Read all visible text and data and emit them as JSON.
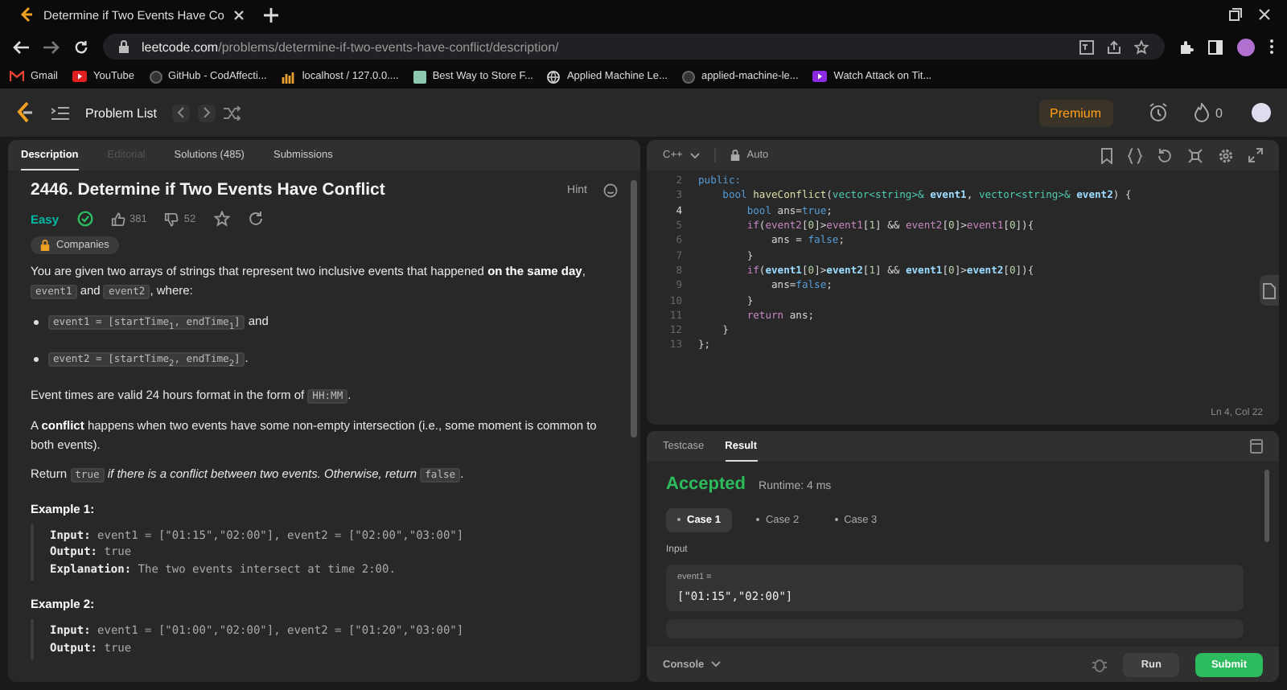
{
  "browser": {
    "tab_title": "Determine if Two Events Have Co",
    "url_host": "leetcode.com",
    "url_path": "/problems/determine-if-two-events-have-conflict/description/",
    "bookmarks": [
      "Gmail",
      "YouTube",
      "GitHub - CodAffecti...",
      "localhost / 127.0.0....",
      "Best Way to Store F...",
      "Applied Machine Le...",
      "applied-machine-le...",
      "Watch Attack on Tit..."
    ]
  },
  "navbar": {
    "title": "Problem List",
    "premium": "Premium",
    "streak": "0"
  },
  "description_panel": {
    "tabs": [
      {
        "label": "Description",
        "selected": true,
        "disabled": false
      },
      {
        "label": "Editorial",
        "selected": false,
        "disabled": true
      },
      {
        "label": "Solutions (485)",
        "selected": false,
        "disabled": false
      },
      {
        "label": "Submissions",
        "selected": false,
        "disabled": false
      }
    ],
    "title": "2446. Determine if Two Events Have Conflict",
    "hint": "Hint",
    "difficulty": "Easy",
    "solved": true,
    "likes": "381",
    "dislikes": "52",
    "companies": "Companies",
    "paragraphs": [
      {
        "kind": "text",
        "segments": [
          {
            "kind": "text",
            "text": "You are given two arrays of strings that represent two inclusive events that happened "
          },
          {
            "kind": "bold",
            "text": "on the same day"
          },
          {
            "kind": "text",
            "text": ", "
          },
          {
            "kind": "code",
            "text": "event1"
          },
          {
            "kind": "text",
            "text": " and "
          },
          {
            "kind": "code",
            "text": "event2"
          },
          {
            "kind": "text",
            "text": ", where:"
          }
        ]
      },
      {
        "kind": "bullet",
        "segments": [
          {
            "kind": "code",
            "text": "event1 = [startTime$_{1}$, endTime$_{1}$]"
          },
          {
            "kind": "text",
            "text": " and"
          }
        ]
      },
      {
        "kind": "bullet",
        "segments": [
          {
            "kind": "code",
            "text": "event2 = [startTime$_{2}$, endTime$_{2}$]"
          },
          {
            "kind": "text",
            "text": "."
          }
        ]
      },
      {
        "kind": "text",
        "segments": [
          {
            "kind": "text",
            "text": "Event times are valid 24 hours format in the form of "
          },
          {
            "kind": "code",
            "text": "HH:MM"
          },
          {
            "kind": "text",
            "text": "."
          }
        ]
      },
      {
        "kind": "text",
        "segments": [
          {
            "kind": "text",
            "text": "A "
          },
          {
            "kind": "bold",
            "text": "conflict"
          },
          {
            "kind": "text",
            "text": " happens when two events have some non-empty intersection (i.e., some moment is common to both events)."
          }
        ]
      },
      {
        "kind": "text",
        "segments": [
          {
            "kind": "text",
            "text": "Return "
          },
          {
            "kind": "code",
            "text": "true"
          },
          {
            "kind": "italic",
            "text": " if there is a conflict between two events. Otherwise, return "
          },
          {
            "kind": "code",
            "text": "false"
          },
          {
            "kind": "text",
            "text": "."
          }
        ]
      }
    ],
    "examples": [
      {
        "heading": "Example 1:",
        "lines": [
          "**Input:** event1 = [\"01:15\",\"02:00\"], event2 = [\"02:00\",\"03:00\"]",
          "**Output:** true",
          "**Explanation:** The two events intersect at time 2:00."
        ]
      },
      {
        "heading": "Example 2:",
        "lines": [
          "**Input:** event1 = [\"01:00\",\"02:00\"], event2 = [\"01:20\",\"03:00\"]",
          "**Output:** true"
        ]
      }
    ]
  },
  "editor": {
    "language": "C++",
    "mode": "Auto",
    "cursor": "Ln 4, Col 22",
    "lines": [
      {
        "number": "2",
        "current": false,
        "tokens": [
          {
            "kind": "kw",
            "text": "public:"
          }
        ]
      },
      {
        "number": "3",
        "current": false,
        "tokens": [
          {
            "kind": "kw",
            "text": "    bool "
          },
          {
            "kind": "fn",
            "text": "haveConflict"
          },
          {
            "kind": "plain",
            "text": "("
          },
          {
            "kind": "type",
            "text": "vector<string>& "
          },
          {
            "kind": "param",
            "text": "event1"
          },
          {
            "kind": "plain",
            "text": ", "
          },
          {
            "kind": "type",
            "text": "vector<string>& "
          },
          {
            "kind": "param",
            "text": "event2"
          },
          {
            "kind": "plain",
            "text": ") {"
          }
        ]
      },
      {
        "number": "4",
        "current": true,
        "tokens": [
          {
            "kind": "kw",
            "text": "        bool"
          },
          {
            "kind": "plain",
            "text": " ans="
          },
          {
            "kind": "kw",
            "text": "true"
          },
          {
            "kind": "plain",
            "text": ";"
          }
        ]
      },
      {
        "number": "5",
        "current": false,
        "tokens": [
          {
            "kind": "ctrl",
            "text": "        if"
          },
          {
            "kind": "plain",
            "text": "("
          },
          {
            "kind": "var",
            "text": "event2"
          },
          {
            "kind": "plain",
            "text": "["
          },
          {
            "kind": "num",
            "text": "0"
          },
          {
            "kind": "plain",
            "text": "]>"
          },
          {
            "kind": "var",
            "text": "event1"
          },
          {
            "kind": "plain",
            "text": "["
          },
          {
            "kind": "num",
            "text": "1"
          },
          {
            "kind": "plain",
            "text": "] && "
          },
          {
            "kind": "var",
            "text": "event2"
          },
          {
            "kind": "plain",
            "text": "["
          },
          {
            "kind": "num",
            "text": "0"
          },
          {
            "kind": "plain",
            "text": "]>"
          },
          {
            "kind": "var",
            "text": "event1"
          },
          {
            "kind": "plain",
            "text": "["
          },
          {
            "kind": "num",
            "text": "0"
          },
          {
            "kind": "plain",
            "text": "]){"
          }
        ]
      },
      {
        "number": "6",
        "current": false,
        "tokens": [
          {
            "kind": "plain",
            "text": "            ans = "
          },
          {
            "kind": "kw",
            "text": "false"
          },
          {
            "kind": "plain",
            "text": ";"
          }
        ]
      },
      {
        "number": "7",
        "current": false,
        "tokens": [
          {
            "kind": "plain",
            "text": "        }"
          }
        ]
      },
      {
        "number": "8",
        "current": false,
        "tokens": [
          {
            "kind": "ctrl",
            "text": "        if"
          },
          {
            "kind": "plain",
            "text": "("
          },
          {
            "kind": "param",
            "text": "event1"
          },
          {
            "kind": "plain",
            "text": "["
          },
          {
            "kind": "num",
            "text": "0"
          },
          {
            "kind": "plain",
            "text": "]>"
          },
          {
            "kind": "param",
            "text": "event2"
          },
          {
            "kind": "plain",
            "text": "["
          },
          {
            "kind": "num",
            "text": "1"
          },
          {
            "kind": "plain",
            "text": "] && "
          },
          {
            "kind": "param",
            "text": "event1"
          },
          {
            "kind": "plain",
            "text": "["
          },
          {
            "kind": "num",
            "text": "0"
          },
          {
            "kind": "plain",
            "text": "]>"
          },
          {
            "kind": "param",
            "text": "event2"
          },
          {
            "kind": "plain",
            "text": "["
          },
          {
            "kind": "num",
            "text": "0"
          },
          {
            "kind": "plain",
            "text": "]){"
          }
        ]
      },
      {
        "number": "9",
        "current": false,
        "tokens": [
          {
            "kind": "plain",
            "text": "            ans="
          },
          {
            "kind": "kw",
            "text": "false"
          },
          {
            "kind": "plain",
            "text": ";"
          }
        ]
      },
      {
        "number": "10",
        "current": false,
        "tokens": [
          {
            "kind": "plain",
            "text": "        }"
          }
        ]
      },
      {
        "number": "11",
        "current": false,
        "tokens": [
          {
            "kind": "ctrl",
            "text": "        return"
          },
          {
            "kind": "plain",
            "text": " ans;"
          }
        ]
      },
      {
        "number": "12",
        "current": false,
        "tokens": [
          {
            "kind": "plain",
            "text": "    }"
          }
        ]
      },
      {
        "number": "13",
        "current": false,
        "tokens": [
          {
            "kind": "plain",
            "text": "};"
          }
        ]
      }
    ]
  },
  "result_panel": {
    "tabs": [
      {
        "label": "Testcase",
        "selected": false
      },
      {
        "label": "Result",
        "selected": true
      }
    ],
    "status": "Accepted",
    "runtime": "Runtime: 4 ms",
    "cases": [
      {
        "label": "Case 1",
        "selected": true
      },
      {
        "label": "Case 2",
        "selected": false
      },
      {
        "label": "Case 3",
        "selected": false
      }
    ],
    "input_label": "Input",
    "inputs": [
      {
        "name": "event1 =",
        "value": "[\"01:15\",\"02:00\"]"
      }
    ],
    "console": "Console",
    "run": "Run",
    "submit": "Submit"
  }
}
